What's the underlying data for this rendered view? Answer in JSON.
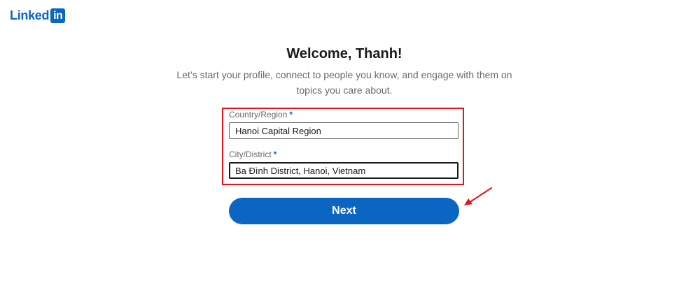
{
  "logo": {
    "text": "Linked",
    "box_text": "in",
    "brand_color": "#0a66c2"
  },
  "heading": {
    "title": "Welcome, Thanh!",
    "subtitle": "Let’s start your profile, connect to people you know, and engage with them on topics you care about."
  },
  "form": {
    "country": {
      "label": "Country/Region",
      "required_marker": "*",
      "value": "Hanoi Capital Region"
    },
    "city": {
      "label": "City/District",
      "required_marker": "*",
      "value": "Ba Đình District, Hanoi, Vietnam"
    },
    "highlight_color": "#e8141b"
  },
  "actions": {
    "next_label": "Next"
  },
  "annotation": {
    "arrow_color": "#e8141b"
  }
}
